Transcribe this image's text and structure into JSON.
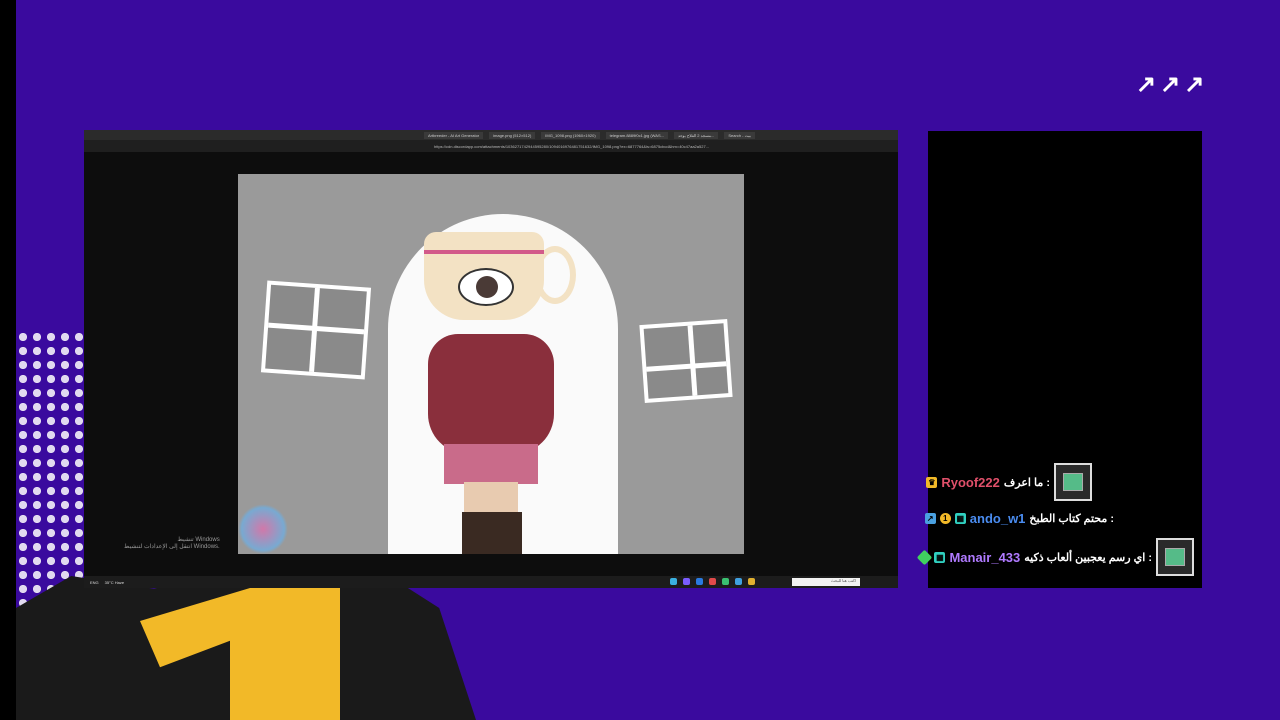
{
  "overlay": {
    "arrows": "↗↗↗",
    "colors": {
      "background": "#3a0a9e",
      "accent_yellow": "#f2b928"
    }
  },
  "browser": {
    "tabs": [
      "Artbreeder - AI Art Generator",
      "image.png (512×512)",
      "IMG_1098.png (1960×1920)",
      "telegram.8889f0c1.jpg (WAS...",
      "مسجد 2 الفلاح يوجد...",
      "Search - بيت"
    ],
    "url": "https://cdn.discordapp.com/attachments/1036271742944595280/1094016976481751632/IMG_1098.png?ex=6877764&is=6875cbcd&hm=40c47aa2a527..."
  },
  "desktop": {
    "activate_line1": "تنشيط Windows",
    "activate_line2": "انتقل إلى الإعدادات لتنشيط Windows.",
    "taskbar_lang": "ENG",
    "taskbar_weather": "35°C Haze",
    "taskbar_search": "اكتب هنا للبحث"
  },
  "chat": {
    "messages": [
      {
        "user": "Ryoof222",
        "user_color": "#e0506a",
        "text": "ما اعرف :",
        "badges": [
          "crown"
        ],
        "has_image": true
      },
      {
        "user": "ando_w1",
        "user_color": "#4a8cf0",
        "text": "محتم كتاب الطبخ :",
        "badges": [
          "blue",
          "gold",
          "teal"
        ],
        "has_image": false
      },
      {
        "user": "Manair_433",
        "user_color": "#b07aff",
        "text": "اي رسم يعجبين ألعاب ذكيه :",
        "badges": [
          "green-diamond",
          "teal"
        ],
        "has_image": true
      }
    ]
  }
}
